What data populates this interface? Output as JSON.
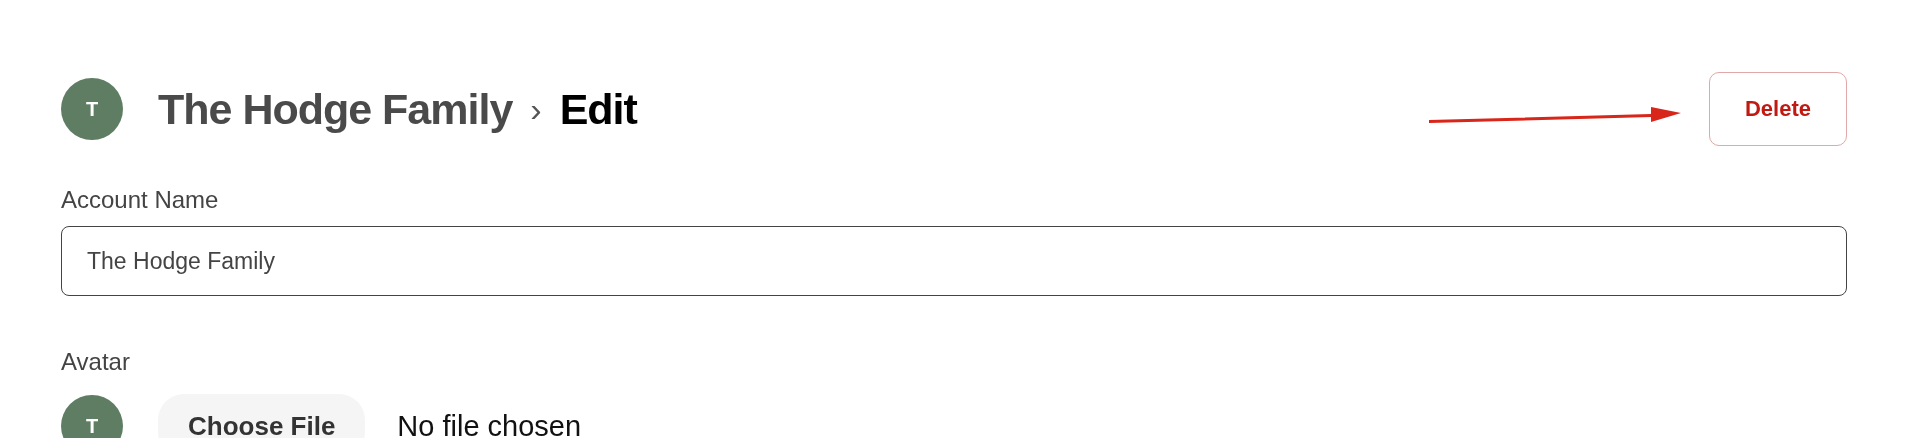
{
  "header": {
    "avatar": {
      "initial": "T",
      "color": "#5e7d62"
    },
    "breadcrumb": [
      "The Hodge Family",
      "›",
      "Edit"
    ],
    "delete_button": "Delete"
  },
  "account_name": {
    "label": "Account Name",
    "value": "The Hodge Family"
  },
  "avatar_field": {
    "label": "Avatar",
    "avatar": {
      "initial": "T",
      "color": "#5e7d62"
    },
    "button": "Choose File",
    "status": "No file chosen"
  }
}
